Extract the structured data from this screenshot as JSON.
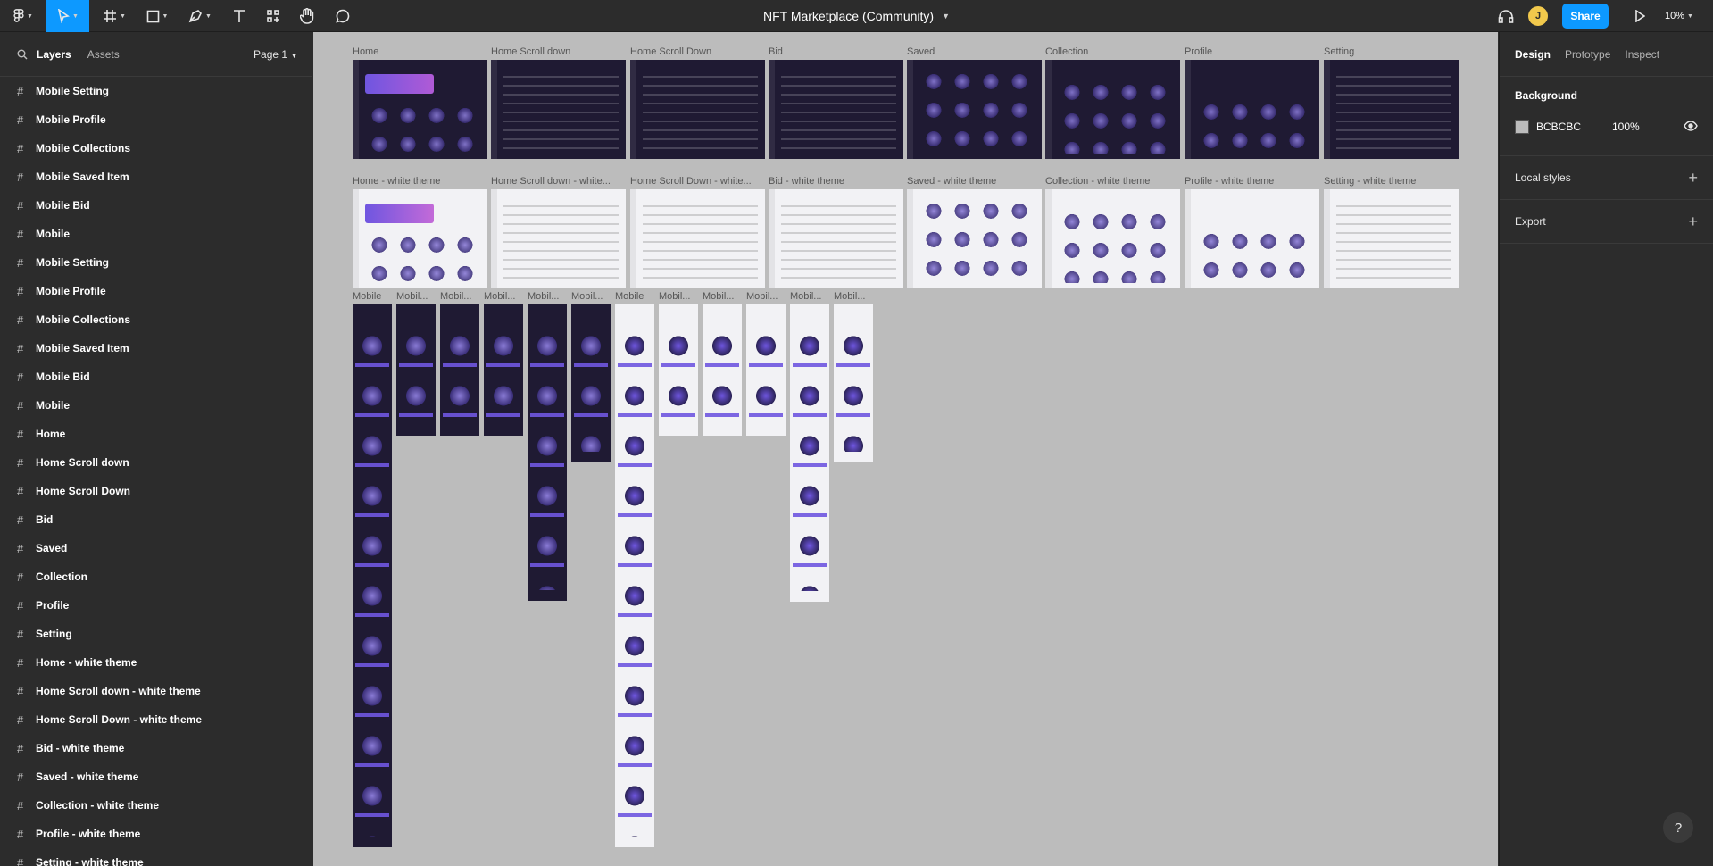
{
  "toolbar": {
    "title": "NFT Marketplace (Community)",
    "avatar_initial": "J",
    "share_label": "Share",
    "zoom": "10%"
  },
  "left_panel": {
    "tabs": [
      "Layers",
      "Assets"
    ],
    "page": "Page 1",
    "layers": [
      "Mobile Setting",
      "Mobile Profile",
      "Mobile Collections",
      "Mobile Saved Item",
      "Mobile Bid",
      "Mobile",
      "Mobile Setting",
      "Mobile Profile",
      "Mobile Collections",
      "Mobile Saved Item",
      "Mobile Bid",
      "Mobile",
      "Home",
      "Home Scroll down",
      "Home Scroll Down",
      "Bid",
      "Saved",
      "Collection",
      "Profile",
      "Setting",
      "Home - white theme",
      "Home Scroll down - white theme",
      "Home Scroll Down - white theme",
      "Bid - white theme",
      "Saved - white theme",
      "Collection - white theme",
      "Profile - white theme",
      "Setting - white theme"
    ]
  },
  "canvas": {
    "dark_frames": [
      "Home",
      "Home Scroll down",
      "Home Scroll Down",
      "Bid",
      "Saved",
      "Collection",
      "Profile",
      "Setting"
    ],
    "light_frames": [
      "Home - white theme",
      "Home Scroll down - white...",
      "Home Scroll Down - white...",
      "Bid - white theme",
      "Saved - white theme",
      "Collection - white theme",
      "Profile - white theme",
      "Setting - white theme"
    ],
    "mobile_frames": [
      "Mobile",
      "Mobil...",
      "Mobil...",
      "Mobil...",
      "Mobil...",
      "Mobil...",
      "Mobile",
      "Mobil...",
      "Mobil...",
      "Mobil...",
      "Mobil...",
      "Mobil..."
    ]
  },
  "right_panel": {
    "tabs": [
      "Design",
      "Prototype",
      "Inspect"
    ],
    "background_title": "Background",
    "bg_hex": "BCBCBC",
    "bg_opacity": "100%",
    "local_styles": "Local styles",
    "export": "Export"
  },
  "help": "?"
}
